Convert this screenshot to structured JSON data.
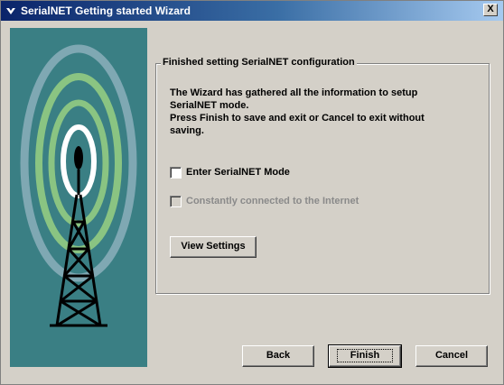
{
  "window": {
    "title": "SerialNET Getting started Wizard",
    "close_glyph": "X"
  },
  "group": {
    "legend": "Finished setting SerialNET configuration",
    "description": [
      "The Wizard has gathered all the information to setup",
      "SerialNET mode.",
      "Press Finish to save and exit or Cancel to exit without",
      "saving."
    ]
  },
  "options": {
    "enter_mode_label": "Enter SerialNET Mode",
    "enter_mode_checked": false,
    "connected_label": "Constantly connected to the Internet",
    "connected_checked": false,
    "connected_enabled": false
  },
  "buttons": {
    "view_settings": "View Settings",
    "back": "Back",
    "finish": "Finish",
    "cancel": "Cancel"
  },
  "colors": {
    "panel_bg": "#3a7f84",
    "ring_outer": "#7fa8b3",
    "ring_green": "#8ac482",
    "ring_inner": "#ffffff",
    "tower": "#000000"
  }
}
